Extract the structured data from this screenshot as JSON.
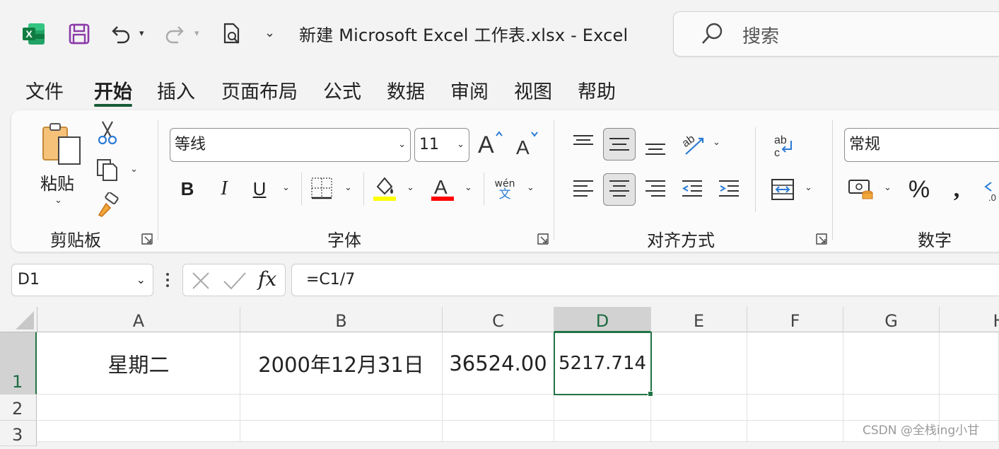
{
  "window": {
    "title": "新建 Microsoft Excel 工作表.xlsx  -  Excel",
    "search_placeholder": "搜索"
  },
  "menu_tabs": [
    "文件",
    "开始",
    "插入",
    "页面布局",
    "公式",
    "数据",
    "审阅",
    "视图",
    "帮助"
  ],
  "active_tab": "开始",
  "ribbon": {
    "clipboard": {
      "paste_label": "粘贴",
      "group_label": "剪贴板"
    },
    "font": {
      "font_name": "等线",
      "font_size": "11",
      "group_label": "字体",
      "phonetic_top": "wén",
      "phonetic_bottom": "文",
      "fill_color": "#ffff00",
      "font_color": "#ff0000"
    },
    "alignment": {
      "group_label": "对齐方式"
    },
    "number": {
      "format": "常规",
      "group_label": "数字"
    }
  },
  "formula_bar": {
    "name_box": "D1",
    "formula": "=C1/7",
    "fx": "fx"
  },
  "sheet": {
    "columns": [
      "A",
      "B",
      "C",
      "D",
      "E",
      "F",
      "G",
      "H"
    ],
    "rows": [
      "1",
      "2",
      "3"
    ],
    "cells": {
      "A1": "星期二",
      "B1": "2000年12月31日",
      "C1": "36524.00",
      "D1": "5217.714"
    },
    "selected_cell": "D1"
  },
  "watermark": "CSDN @全栈ing小甘",
  "colors": {
    "accent_green": "#217346",
    "tab_underline": "#185c37"
  }
}
